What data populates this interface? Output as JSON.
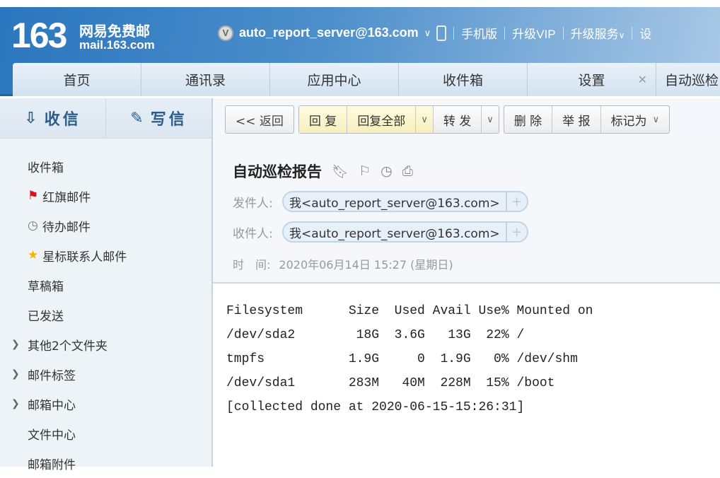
{
  "header": {
    "logo_number": "163",
    "logo_name": "网易免费邮",
    "logo_domain": "mail.163.com",
    "vip_badge": "V",
    "account": "auto_report_server@163.com",
    "nav": [
      "手机版",
      "升级VIP",
      "升级服务",
      "设"
    ]
  },
  "tabs": [
    {
      "label": "首页"
    },
    {
      "label": "通讯录"
    },
    {
      "label": "应用中心"
    },
    {
      "label": "收件箱"
    },
    {
      "label": "设置",
      "closable": true
    },
    {
      "label": "自动巡检"
    }
  ],
  "sidebar": {
    "receive": "收信",
    "compose": "写信",
    "folders": [
      {
        "label": "收件箱",
        "icon": ""
      },
      {
        "label": "红旗邮件",
        "icon": "flag"
      },
      {
        "label": "待办邮件",
        "icon": "clock"
      },
      {
        "label": "星标联系人邮件",
        "icon": "star"
      },
      {
        "label": "草稿箱",
        "icon": ""
      },
      {
        "label": "已发送",
        "icon": ""
      },
      {
        "label": "其他2个文件夹",
        "expandable": true
      },
      {
        "label": "邮件标签",
        "expandable": true
      },
      {
        "label": "邮箱中心",
        "expandable": true
      },
      {
        "label": "文件中心",
        "icon": ""
      },
      {
        "label": "邮箱附件",
        "icon": ""
      }
    ]
  },
  "toolbar": {
    "back": "<< 返回",
    "reply": "回 复",
    "reply_all": "回复全部",
    "forward": "转 发",
    "delete": "删 除",
    "report": "举 报",
    "mark_as": "标记为"
  },
  "mail": {
    "subject": "自动巡检报告",
    "from_label": "发件人:",
    "from": "我<auto_report_server@163.com>",
    "to_label": "收件人:",
    "to": "我<auto_report_server@163.com>",
    "time_label": "时　间:",
    "time": "2020年06月14日 15:27 (星期日)",
    "body": "Filesystem      Size  Used Avail Use% Mounted on\n/dev/sda2        18G  3.6G   13G  22% /\ntmpfs           1.9G     0  1.9G   0% /dev/shm\n/dev/sda1       283M   40M  228M  15% /boot\n[collected done at 2020-06-15-15:26:31]"
  },
  "colors": {
    "header_blue": "#2a76be",
    "flag_red": "#d9141b",
    "star_yellow": "#f5b400"
  }
}
